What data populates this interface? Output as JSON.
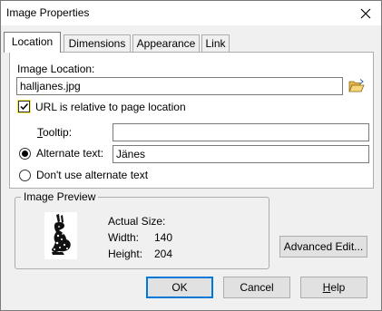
{
  "window": {
    "title": "Image Properties"
  },
  "tabs": [
    {
      "label": "Location"
    },
    {
      "label": "Dimensions"
    },
    {
      "label": "Appearance"
    },
    {
      "label": "Link"
    }
  ],
  "location": {
    "image_location_label": "Image Location:",
    "image_location_value": "halljanes.jpg",
    "relative_checkbox_label": "URL is relative to page location",
    "relative_checked": true,
    "tooltip_label": "Tooltip:",
    "tooltip_value": "",
    "alt_text_label": "Alternate text:",
    "alt_text_value": "Jänes",
    "alt_text_selected": true,
    "no_alt_label": "Don't use alternate text"
  },
  "preview": {
    "group_title": "Image Preview",
    "actual_size_label": "Actual Size:",
    "width_label": "Width:",
    "width_value": "140",
    "height_label": "Height:",
    "height_value": "204"
  },
  "buttons": {
    "advanced_edit": "Advanced Edit...",
    "ok": "OK",
    "cancel": "Cancel",
    "help": "Help"
  },
  "icons": {
    "close": "close-icon",
    "browse": "folder-open-icon"
  },
  "colors": {
    "focus_highlight": "#f5e942",
    "default_button_border": "#0078d7",
    "dialog_background": "#f0f0f0"
  }
}
